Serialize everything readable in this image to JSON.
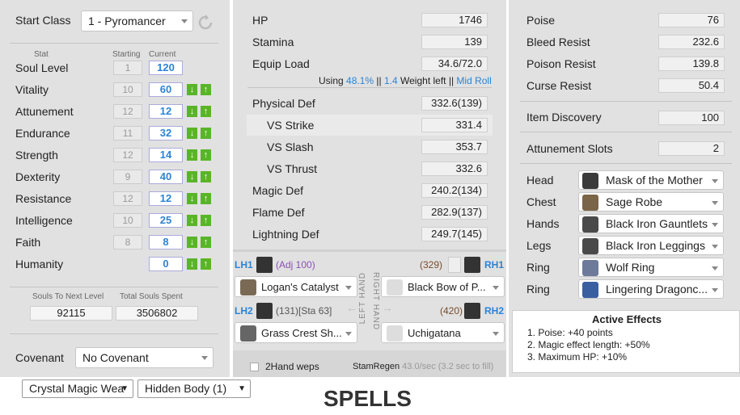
{
  "left": {
    "start_class_label": "Start Class",
    "start_class_value": "1 - Pyromancer",
    "stat_header": "Stat",
    "starting_header": "Starting",
    "current_header": "Current",
    "soul_level": {
      "label": "Soul Level",
      "starting": "1",
      "current": "120"
    },
    "stats": [
      {
        "label": "Vitality",
        "starting": "10",
        "current": "60"
      },
      {
        "label": "Attunement",
        "starting": "12",
        "current": "12"
      },
      {
        "label": "Endurance",
        "starting": "11",
        "current": "32"
      },
      {
        "label": "Strength",
        "starting": "12",
        "current": "14"
      },
      {
        "label": "Dexterity",
        "starting": "9",
        "current": "40"
      },
      {
        "label": "Resistance",
        "starting": "12",
        "current": "12"
      },
      {
        "label": "Intelligence",
        "starting": "10",
        "current": "25"
      },
      {
        "label": "Faith",
        "starting": "8",
        "current": "8"
      },
      {
        "label": "Humanity",
        "starting": "",
        "current": "0"
      }
    ],
    "souls_next_label": "Souls To Next Level",
    "souls_next_value": "92115",
    "souls_spent_label": "Total Souls Spent",
    "souls_spent_value": "3506802",
    "covenant_label": "Covenant",
    "covenant_value": "No Covenant"
  },
  "mid": {
    "rows": [
      {
        "label": "HP",
        "value": "1746"
      },
      {
        "label": "Stamina",
        "value": "139"
      },
      {
        "label": "Equip Load",
        "value": "34.6/72.0"
      }
    ],
    "using_label": "Using",
    "using_pct": "48.1%",
    "sep1": "||",
    "weight_left_value": "1.4",
    "weight_left_label": "Weight left",
    "sep2": "||",
    "roll": "Mid Roll",
    "defs": [
      {
        "label": "Physical Def",
        "value": "332.6(139)"
      },
      {
        "label": "VS Strike",
        "value": "331.4"
      },
      {
        "label": "VS Slash",
        "value": "353.7"
      },
      {
        "label": "VS Thrust",
        "value": "332.6"
      },
      {
        "label": "Magic Def",
        "value": "240.2(134)"
      },
      {
        "label": "Flame Def",
        "value": "282.9(137)"
      },
      {
        "label": "Lightning Def",
        "value": "249.7(145)"
      }
    ],
    "lh1": "LH1",
    "lh1_adj": "(Adj 100)",
    "lh1_weapon": "Logan's Catalyst",
    "rh1": "RH1",
    "rh1_num": "(329)",
    "rh1_weapon": "Black Bow of P...",
    "lh2": "LH2",
    "lh2_info": "(131)[Sta 63]",
    "lh2_weapon": "Grass Crest Sh...",
    "rh2": "RH2",
    "rh2_num": "(420)",
    "rh2_weapon": "Uchigatana",
    "left_hand_text": "LEFT HAND",
    "right_hand_text": "RIGHT HAND",
    "two_hand_label": "2Hand weps",
    "stam_regen_label": "StamRegen",
    "stam_regen_value": "43.0/sec (3.2 sec to fill)"
  },
  "right": {
    "stats": [
      {
        "label": "Poise",
        "value": "76"
      },
      {
        "label": "Bleed Resist",
        "value": "232.6"
      },
      {
        "label": "Poison Resist",
        "value": "139.8"
      },
      {
        "label": "Curse Resist",
        "value": "50.4"
      }
    ],
    "item_discovery": {
      "label": "Item Discovery",
      "value": "100"
    },
    "attunement_slots": {
      "label": "Attunement Slots",
      "value": "2"
    },
    "equipment": [
      {
        "slot": "Head",
        "item": "Mask of the Mother"
      },
      {
        "slot": "Chest",
        "item": "Sage Robe"
      },
      {
        "slot": "Hands",
        "item": "Black Iron Gauntlets"
      },
      {
        "slot": "Legs",
        "item": "Black Iron Leggings"
      },
      {
        "slot": "Ring",
        "item": "Wolf Ring"
      },
      {
        "slot": "Ring",
        "item": "Lingering Dragonc..."
      }
    ],
    "active_effects_title": "Active Effects",
    "active_effects": [
      "1. Poise: +40 points",
      "2. Magic effect length: +50%",
      "3. Maximum HP: +10%"
    ]
  },
  "bottom": {
    "select1": "Crystal Magic Wea",
    "select2": "Hidden Body (1)",
    "spells_title": "SPELLS"
  }
}
